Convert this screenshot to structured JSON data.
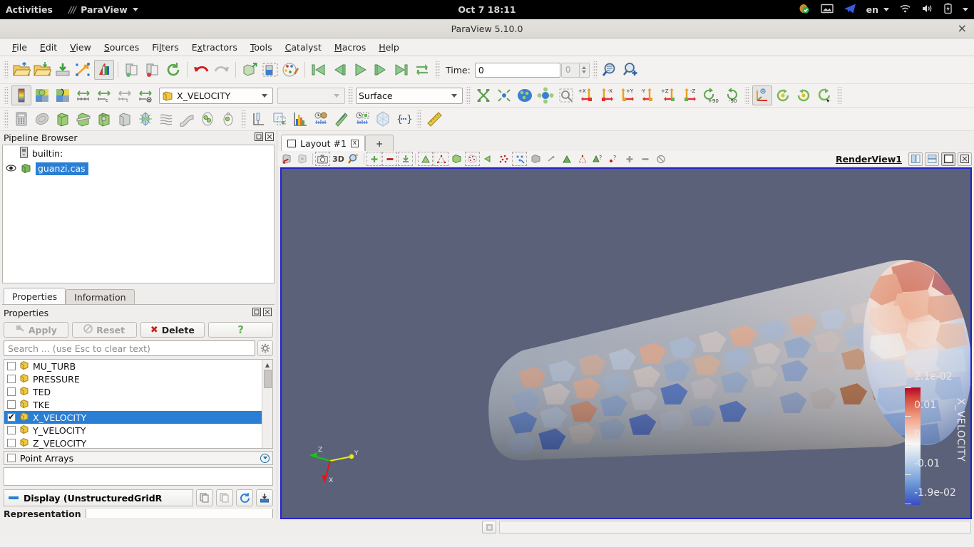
{
  "desktop": {
    "activities": "Activities",
    "app_menu": "ParaView",
    "clock": "Oct 7  18:11",
    "tray": {
      "language": "en",
      "icons": [
        "shield-check-icon",
        "screenshot-icon",
        "telegram-icon",
        "wifi-icon",
        "volume-icon",
        "battery-icon",
        "chevron-down-icon"
      ]
    }
  },
  "window": {
    "title": "ParaView 5.10.0",
    "close": "×"
  },
  "menubar": [
    {
      "label": "File",
      "mnemonic": "F"
    },
    {
      "label": "Edit",
      "mnemonic": "E"
    },
    {
      "label": "View",
      "mnemonic": "V"
    },
    {
      "label": "Sources",
      "mnemonic": "S"
    },
    {
      "label": "Filters",
      "mnemonic": "l"
    },
    {
      "label": "Extractors",
      "mnemonic": "x"
    },
    {
      "label": "Tools",
      "mnemonic": "T"
    },
    {
      "label": "Catalyst",
      "mnemonic": "C"
    },
    {
      "label": "Macros",
      "mnemonic": "M"
    },
    {
      "label": "Help",
      "mnemonic": "H"
    }
  ],
  "toolbar_main": {
    "time_label": "Time:",
    "time_value": "0",
    "frame_value": "0",
    "buttons": [
      "open-file-icon",
      "recent-files-icon",
      "save-data-icon",
      "save-screenshot-icon",
      "save-state-icon",
      "connect-server-icon",
      "disconnect-server-icon",
      "reset-session-icon",
      "undo-icon",
      "redo-icon",
      "camera-undo-icon",
      "capture-screenshot-region-icon",
      "edit-color-map-icon",
      "first-frame-icon",
      "previous-frame-icon",
      "play-icon",
      "next-frame-icon",
      "last-frame-icon",
      "loop-icon",
      "find-data-icon",
      "add-data-icon"
    ]
  },
  "toolbar_color": {
    "array_name": "X_VELOCITY",
    "component": "",
    "representation": "Surface",
    "buttons": [
      "toggle-color-legend-icon",
      "edit-color-map-icon",
      "rescale-custom-icon",
      "rescale-data-range-icon",
      "rescale-custom-range-icon",
      "rescale-over-time-icon",
      "rescale-visible-icon",
      "reset-camera-icon",
      "zoom-closest-icon",
      "reset-camera-closest-icon",
      "zoom-to-box-icon",
      "zoom-to-data-icon",
      "camera-plus-x-icon",
      "camera-minus-x-icon",
      "camera-plus-y-icon",
      "camera-minus-y-icon",
      "camera-plus-z-icon",
      "camera-minus-z-icon",
      "rotate-90-icon",
      "rotate-minus-90-icon",
      "center-axes-visibility-icon",
      "rotate-ccw-icon",
      "rotate-cw-icon",
      "spin-icon"
    ]
  },
  "toolbar_filters": {
    "buttons": [
      "calculator-icon",
      "contour-icon",
      "clip-icon",
      "slice-icon",
      "threshold-icon",
      "extract-subset-icon",
      "glyph-icon",
      "stream-tracer-icon",
      "warp-icon",
      "group-datasets-icon",
      "extract-level-icon",
      "plot-over-line-icon",
      "extract-selection-icon",
      "histogram-icon",
      "plot-data-over-time-icon",
      "plot-on-sorted-lines-icon",
      "plot-selection-over-time-icon",
      "gradient-icon",
      "python-calculator-icon",
      "ruler-icon"
    ]
  },
  "pipeline": {
    "title": "Pipeline Browser",
    "header_icons": [
      "undock-icon",
      "close-panel-icon"
    ],
    "items": [
      {
        "label": "builtin:",
        "type": "server",
        "selected": false,
        "eye": false
      },
      {
        "label": "guanzi.cas",
        "type": "source",
        "selected": true,
        "eye": true
      }
    ]
  },
  "properties": {
    "tabs": [
      {
        "label": "Properties",
        "active": true
      },
      {
        "label": "Information",
        "active": false
      }
    ],
    "title": "Properties",
    "header_icons": [
      "undock-icon",
      "close-panel-icon"
    ],
    "buttons": [
      {
        "label": "Apply",
        "icon": "apply-icon",
        "enabled": false
      },
      {
        "label": "Reset",
        "icon": "reset-icon",
        "enabled": false
      },
      {
        "label": "Delete",
        "icon": "delete-icon",
        "enabled": true
      },
      {
        "label": "?",
        "icon": "help-icon",
        "enabled": true
      }
    ],
    "search_placeholder": "Search ... (use Esc to clear text)",
    "gear_icon": "gear-icon",
    "cell_arrays": [
      {
        "label": "MU_TURB",
        "checked": false,
        "selected": false
      },
      {
        "label": "PRESSURE",
        "checked": false,
        "selected": false
      },
      {
        "label": "TED",
        "checked": false,
        "selected": false
      },
      {
        "label": "TKE",
        "checked": false,
        "selected": false
      },
      {
        "label": "X_VELOCITY",
        "checked": true,
        "selected": true
      },
      {
        "label": "Y_VELOCITY",
        "checked": false,
        "selected": false
      },
      {
        "label": "Z_VELOCITY",
        "checked": false,
        "selected": false
      }
    ],
    "point_arrays": {
      "label": "Point Arrays",
      "checked": false,
      "expander": "expand-icon"
    },
    "display_section": {
      "label": "Display (UnstructuredGridR",
      "icons": [
        "copy-properties-icon",
        "paste-properties-icon",
        "restore-defaults-icon",
        "save-defaults-icon"
      ]
    },
    "representation_label": "Representation"
  },
  "layout": {
    "tabs": [
      {
        "label": "Layout #1",
        "close": "x",
        "active": true
      },
      {
        "label": "+",
        "active": false
      }
    ],
    "view_name": "RenderView1",
    "view_toolbar_buttons": [
      "interactive-select-cells-icon",
      "interactive-select-points-icon",
      "screenshot-view-icon",
      "3d-label",
      "zoom-to-box-icon",
      "select-cells-icon",
      "select-points-icon",
      "select-blocks-icon",
      "select-cells-polygon-icon",
      "select-points-polygon-icon",
      "select-frustum-cells-icon",
      "select-frustum-points-icon",
      "select-blocks-frustum-icon",
      "hover-points-icon",
      "hover-cells-icon",
      "interactive-zoom-icon",
      "select-custom-icon",
      "add-point-icon",
      "pick-center-icon",
      "query-point-icon",
      "query-cell-icon",
      "plus-icon",
      "minus-icon",
      "clear-selection-icon"
    ],
    "split_buttons": [
      "split-horizontal-icon",
      "split-vertical-icon",
      "maximize-icon",
      "close-view-icon"
    ]
  },
  "render_view": {
    "background_color": "#5b6179",
    "orientation_axes": [
      {
        "label": "X",
        "color": "#e81414"
      },
      {
        "label": "Y",
        "color": "#e8e814"
      },
      {
        "label": "Z",
        "color": "#14c814"
      }
    ]
  },
  "color_legend": {
    "title": "X_VELOCITY",
    "ticks": [
      "2.1e-02",
      "0.01",
      "0",
      "-0.01",
      "-1.9e-02"
    ],
    "range_min": -0.019,
    "range_max": 0.021,
    "colormap": "Cool to Warm",
    "colors": {
      "high": "#b30326",
      "mid": "#f7f7f5",
      "low": "#3b4cc0"
    }
  },
  "statusbar": {
    "button_icon": "progress-abort-icon",
    "message": ""
  }
}
